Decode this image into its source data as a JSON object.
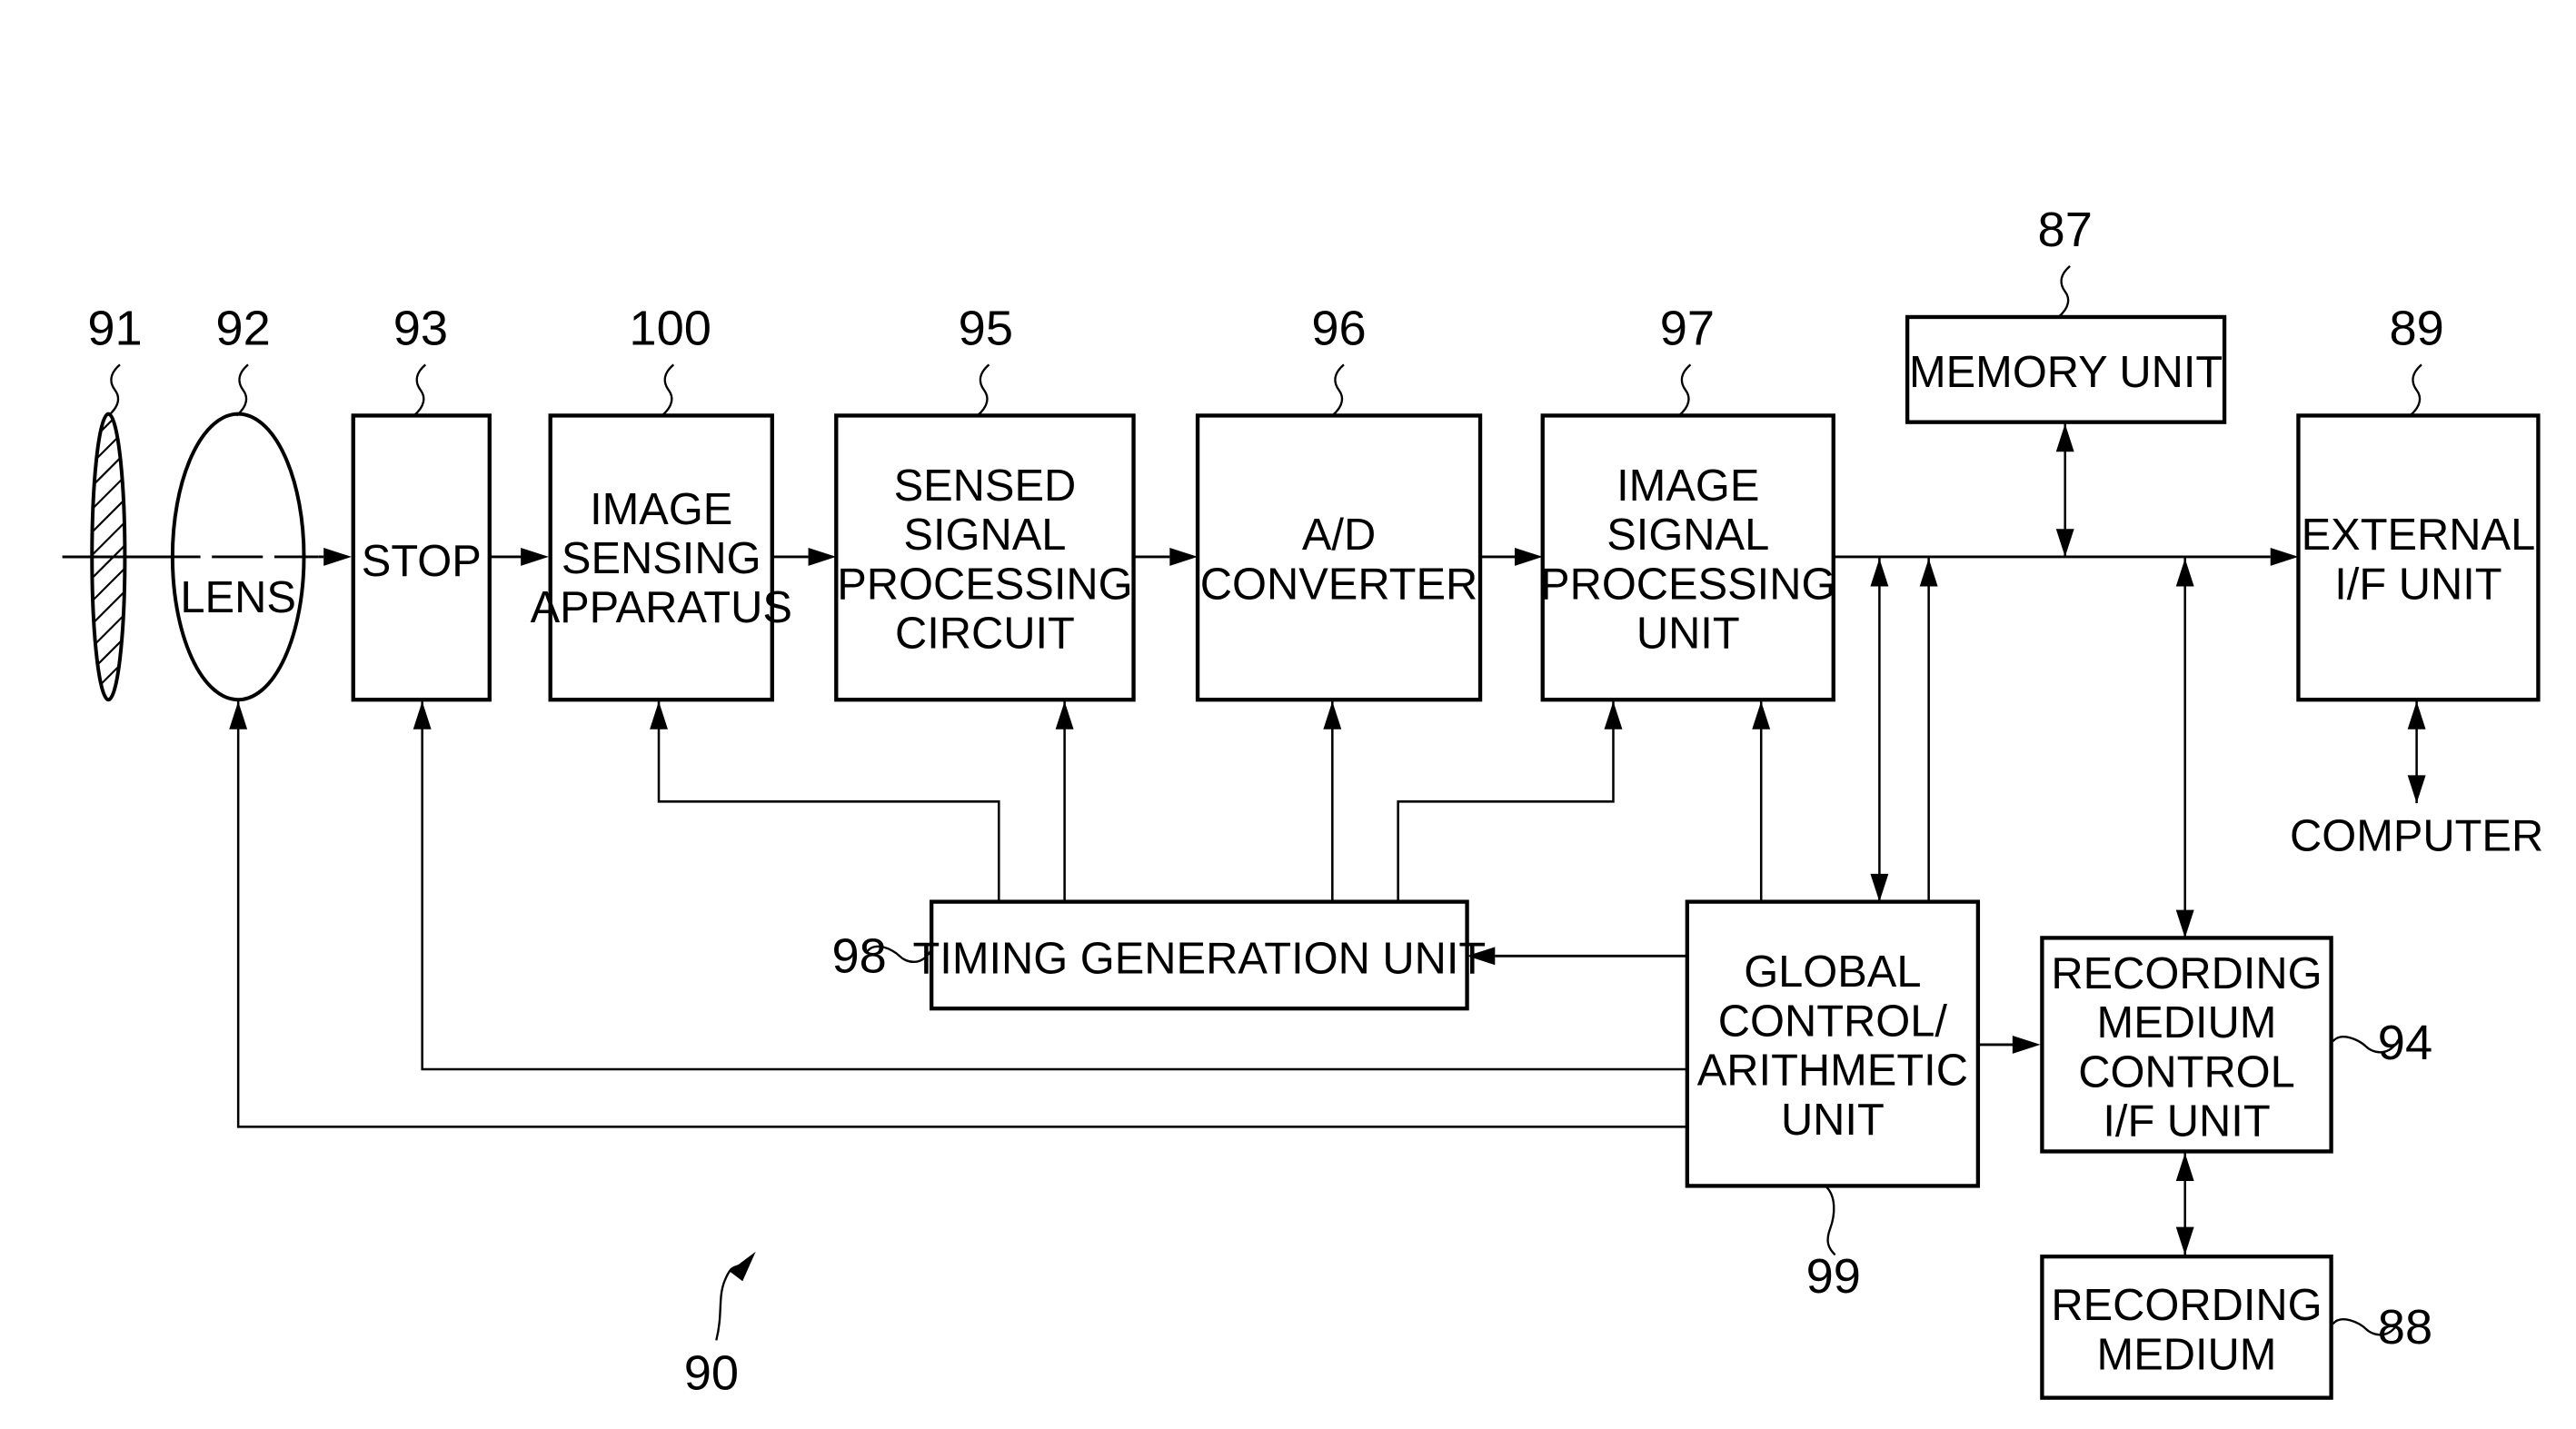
{
  "figure": {
    "reference_numeral": "90"
  },
  "components": {
    "filter": {
      "ref": "91",
      "lines": []
    },
    "lens": {
      "ref": "92",
      "lines": [
        "LENS"
      ]
    },
    "stop": {
      "ref": "93",
      "lines": [
        "STOP"
      ]
    },
    "image_sensing": {
      "ref": "100",
      "lines": [
        "IMAGE",
        "SENSING",
        "APPARATUS"
      ]
    },
    "sensed_signal": {
      "ref": "95",
      "lines": [
        "SENSED",
        "SIGNAL",
        "PROCESSING",
        "CIRCUIT"
      ]
    },
    "ad_converter": {
      "ref": "96",
      "lines": [
        "A/D",
        "CONVERTER"
      ]
    },
    "image_signal": {
      "ref": "97",
      "lines": [
        "IMAGE",
        "SIGNAL",
        "PROCESSING",
        "UNIT"
      ]
    },
    "memory": {
      "ref": "87",
      "lines": [
        "MEMORY UNIT"
      ]
    },
    "external_if": {
      "ref": "89",
      "lines": [
        "EXTERNAL",
        "I/F UNIT"
      ]
    },
    "timing": {
      "ref": "98",
      "lines": [
        "TIMING GENERATION UNIT"
      ]
    },
    "global_control": {
      "ref": "99",
      "lines": [
        "GLOBAL",
        "CONTROL/",
        "ARITHMETIC",
        "UNIT"
      ]
    },
    "rec_ctrl": {
      "ref": "94",
      "lines": [
        "RECORDING",
        "MEDIUM",
        "CONTROL",
        "I/F UNIT"
      ]
    },
    "rec_medium": {
      "ref": "88",
      "lines": [
        "RECORDING",
        "MEDIUM"
      ]
    }
  },
  "external_labels": {
    "computer": "COMPUTER"
  },
  "connections": [
    {
      "from": "lens",
      "to": "stop",
      "kind": "optical-axis"
    },
    {
      "from": "stop",
      "to": "image_sensing",
      "kind": "signal"
    },
    {
      "from": "image_sensing",
      "to": "sensed_signal",
      "kind": "signal"
    },
    {
      "from": "sensed_signal",
      "to": "ad_converter",
      "kind": "signal"
    },
    {
      "from": "ad_converter",
      "to": "image_signal",
      "kind": "signal"
    },
    {
      "from": "image_signal",
      "to": "external_if",
      "kind": "bus"
    },
    {
      "from": "memory",
      "to": "bus",
      "kind": "bidirectional"
    },
    {
      "from": "bus",
      "to": "global_control",
      "kind": "bidirectional"
    },
    {
      "from": "global_control",
      "to": "bus",
      "kind": "signal"
    },
    {
      "from": "bus",
      "to": "rec_ctrl",
      "kind": "bidirectional"
    },
    {
      "from": "external_if",
      "to": "computer",
      "kind": "bidirectional"
    },
    {
      "from": "rec_ctrl",
      "to": "rec_medium",
      "kind": "bidirectional"
    },
    {
      "from": "global_control",
      "to": "rec_ctrl",
      "kind": "signal"
    },
    {
      "from": "global_control",
      "to": "timing",
      "kind": "signal"
    },
    {
      "from": "global_control",
      "to": "image_signal",
      "kind": "signal"
    },
    {
      "from": "global_control",
      "to": "stop",
      "kind": "control"
    },
    {
      "from": "global_control",
      "to": "lens",
      "kind": "control"
    },
    {
      "from": "timing",
      "to": "image_sensing",
      "kind": "timing"
    },
    {
      "from": "timing",
      "to": "sensed_signal",
      "kind": "timing"
    },
    {
      "from": "timing",
      "to": "ad_converter",
      "kind": "timing"
    },
    {
      "from": "timing",
      "to": "image_signal",
      "kind": "timing"
    }
  ]
}
